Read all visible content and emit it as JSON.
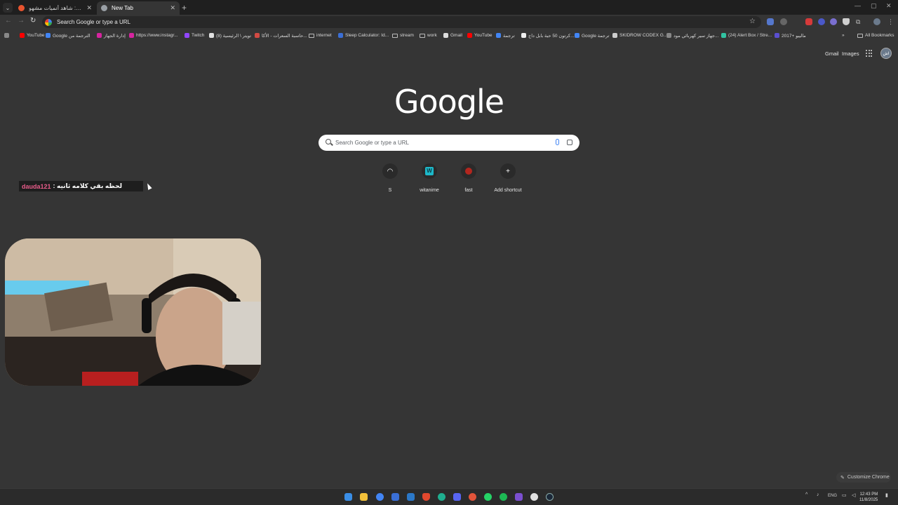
{
  "tabs": [
    {
      "label": "كراشي رول: شاهد أنميات مشهو...",
      "favicon_color": "#e8542f",
      "active": false
    },
    {
      "label": "New Tab",
      "favicon_color": "#9aa0a6",
      "active": true
    }
  ],
  "toolbar": {
    "omnibox_text": "Search Google or type a URL"
  },
  "bookmarks": [
    {
      "label": "YouTube",
      "icon": "youtube-icon",
      "color": "#ff0000"
    },
    {
      "label": "Google الترجمة من",
      "icon": "google-translate-icon",
      "color": "#4285f4"
    },
    {
      "label": "إدارة الجهاز",
      "icon": "instagram-icon",
      "color": "#d6249f"
    },
    {
      "label": "https://www.instagr...",
      "icon": "instagram-icon",
      "color": "#d6249f"
    },
    {
      "label": "Twitch",
      "icon": "twitch-icon",
      "color": "#9146ff"
    },
    {
      "label": "(8) تويتر \\ الرئيسية",
      "icon": "x-icon",
      "color": "#e0e0e0"
    },
    {
      "label": "حاسبة السعرات - الأكا...",
      "icon": "calc-icon",
      "color": "#d24a43"
    },
    {
      "label": "internet",
      "icon": "folder-icon",
      "color": "folder"
    },
    {
      "label": "Sleep Calculator: Id...",
      "icon": "sleep-icon",
      "color": "#3b6fd6"
    },
    {
      "label": "stream",
      "icon": "folder-icon",
      "color": "folder"
    },
    {
      "label": "work",
      "icon": "folder-icon",
      "color": "folder"
    },
    {
      "label": "Gmail",
      "icon": "gmail-icon",
      "color": "#dddddd"
    },
    {
      "label": "YouTube",
      "icon": "youtube-icon",
      "color": "#ff0000"
    },
    {
      "label": "ترجمة",
      "icon": "google-translate-icon",
      "color": "#4285f4"
    },
    {
      "label": "كرتون 50 حبة بابل داج...",
      "icon": "page-icon",
      "color": "#eeeeee"
    },
    {
      "label": "Google ترجمة",
      "icon": "google-translate-icon",
      "color": "#4285f4"
    },
    {
      "label": "SKIDROW CODEX G...",
      "icon": "skull-icon",
      "color": "#cccccc"
    },
    {
      "label": "جهاز سير كهربائي مود...",
      "icon": "page-icon",
      "color": "#888888"
    },
    {
      "label": "(24) Alert Box / Stre...",
      "icon": "alert-icon",
      "color": "#31c3a2"
    },
    {
      "label": "ماليبو +2017",
      "icon": "pw-icon",
      "color": "#5a4fcf"
    }
  ],
  "bookmarks_more": "»",
  "all_bookmarks": "All Bookmarks",
  "ntp": {
    "gmail": "Gmail",
    "images": "Images",
    "avatar_text": "اش",
    "logo": "Google",
    "search_placeholder": "Search Google or type a URL",
    "shortcuts": [
      {
        "name": "S",
        "glyph": "◠",
        "color": "#2a2a2a"
      },
      {
        "name": "witanime",
        "glyph": "W",
        "color": "#1db8c9"
      },
      {
        "name": "fast",
        "glyph": "●",
        "color": "#c0392b"
      },
      {
        "name": "Add shortcut",
        "glyph": "+",
        "color": "#2a2a2a"
      }
    ],
    "customize": "Customize Chrome"
  },
  "chat": {
    "user": "dauda121",
    "message": ": لحظه بقي كلامه ثانيه"
  },
  "taskbar": {
    "language": "ENG",
    "time": "12:43 PM",
    "date": "11/8/2025"
  }
}
